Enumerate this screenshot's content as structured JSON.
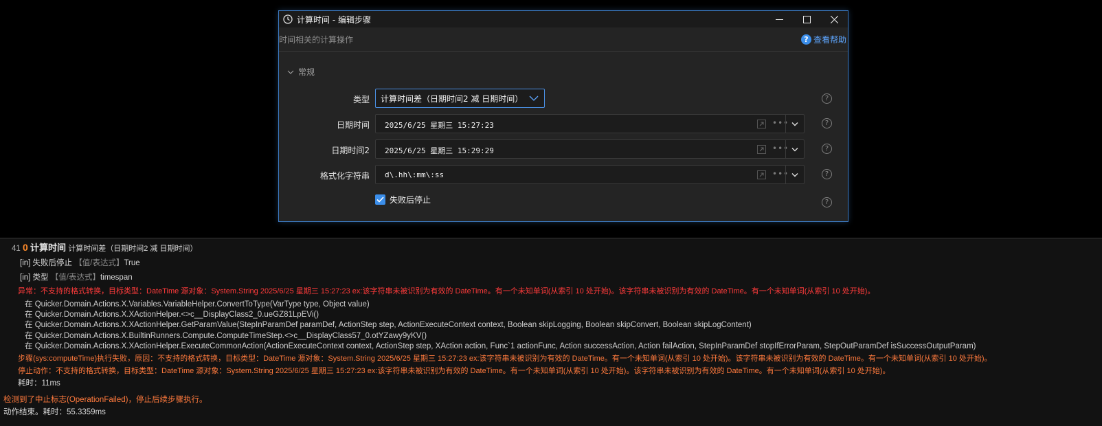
{
  "dialog": {
    "title": "计算时间 - 编辑步骤",
    "subtitle": "时间相关的计算操作",
    "help_label": "查看帮助",
    "section_label": "常规",
    "fields": {
      "type_label": "类型",
      "type_value": "计算时间差（日期时间2 减 日期时间）",
      "datetime1_label": "日期时间",
      "datetime1_value": "2025/6/25 星期三 15:27:23",
      "datetime2_label": "日期时间2",
      "datetime2_value": "2025/6/25 星期三 15:29:29",
      "format_label": "格式化字符串",
      "format_value": "d\\.hh\\:mm\\:ss",
      "stop_on_fail_label": "失败后停止"
    }
  },
  "log": {
    "header_index": "41",
    "header_zero": "0",
    "header_title": "计算时间",
    "header_desc": "计算时间差（日期时间2 减 日期时间）",
    "in1_prefix": "[in] 失败后停止",
    "in1_hint": "【值/表达式】",
    "in1_value": "True",
    "in2_prefix": "[in] 类型",
    "in2_hint": "【值/表达式】",
    "in2_value": "timespan",
    "error_line": "异常：不支持的格式转换，目标类型：DateTime  源对象：System.String  2025/6/25 星期三 15:27:23 ex:该字符串未被识别为有效的 DateTime。有一个未知单词(从索引 10 处开始)。该字符串未被识别为有效的 DateTime。有一个未知单词(从索引 10 处开始)。",
    "trace": [
      "在 Quicker.Domain.Actions.X.Variables.VariableHelper.ConvertToType(VarType type, Object value)",
      "在 Quicker.Domain.Actions.X.XActionHelper.<>c__DisplayClass2_0.ueGZ81LpEVi()",
      "在 Quicker.Domain.Actions.X.XActionHelper.GetParamValue(StepInParamDef paramDef, ActionStep step, ActionExecuteContext context, Boolean skipLogging, Boolean skipConvert, Boolean skipLogContent)",
      "在 Quicker.Domain.Actions.X.BuiltinRunners.Compute.ComputeTimeStep.<>c__DisplayClass57_0.otYZawy9yKV()",
      "在 Quicker.Domain.Actions.X.XActionHelper.ExecuteCommonAction(ActionExecuteContext context, ActionStep step, XAction action, Func`1 actionFunc, Action successAction, Action failAction, StepInParamDef stopIfErrorParam, StepOutParamDef isSuccessOutputParam)"
    ],
    "step_fail_line": "步骤(sys:computeTime)执行失败，原因：不支持的格式转换，目标类型：DateTime  源对象：System.String  2025/6/25 星期三 15:27:23 ex:该字符串未被识别为有效的 DateTime。有一个未知单词(从索引 10 处开始)。该字符串未被识别为有效的 DateTime。有一个未知单词(从索引 10 处开始)。",
    "stop_line": "停止动作：不支持的格式转换，目标类型：DateTime  源对象：System.String  2025/6/25 星期三 15:27:23 ex:该字符串未被识别为有效的 DateTime。有一个未知单词(从索引 10 处开始)。该字符串未被识别为有效的 DateTime。有一个未知单词(从索引 10 处开始)。",
    "elapsed_line": "耗时：11ms",
    "abort_line": "检测到了中止标志(OperationFailed)，停止后续步骤执行。",
    "end_line": "动作结束。耗时：55.3359ms"
  },
  "colors": {
    "accent": "#3b8eea",
    "error": "#ff3b3b",
    "warning": "#ff7a3d"
  }
}
